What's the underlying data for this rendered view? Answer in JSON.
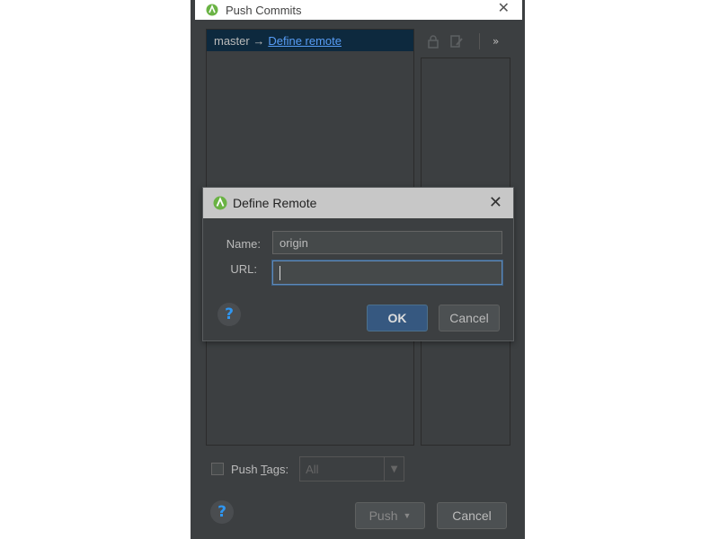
{
  "push_window": {
    "title": "Push Commits",
    "branch": "master →",
    "define_remote_link": "Define remote",
    "more": "»",
    "push_tags_label_prefix": "Push ",
    "push_tags_label_underlined": "T",
    "push_tags_label_suffix": "ags:",
    "tags_select_value": "All",
    "push_button": "Push",
    "cancel_button": "Cancel",
    "push_tags_checked": false
  },
  "dialog": {
    "title": "Define Remote",
    "name_label": "Name:",
    "name_value": "origin",
    "url_label": "URL:",
    "url_value": "",
    "ok_button": "OK",
    "cancel_button": "Cancel"
  },
  "icons": {
    "app": "android-studio-icon",
    "help": "?"
  },
  "colors": {
    "accent": "#365880",
    "link": "#589df6",
    "selection": "#0d293e",
    "background": "#3c3f41"
  }
}
